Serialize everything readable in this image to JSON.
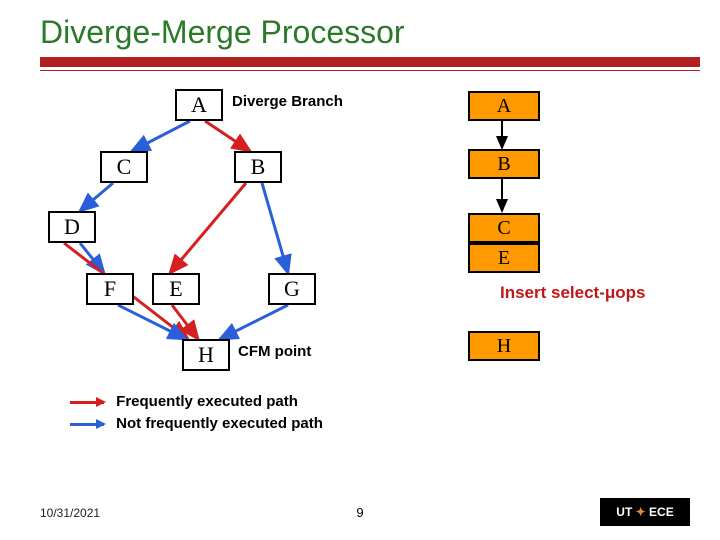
{
  "title": "Diverge-Merge Processor",
  "nodes": {
    "A": "A",
    "B": "B",
    "C": "C",
    "D": "D",
    "E": "E",
    "F": "F",
    "G": "G",
    "H": "H"
  },
  "labels": {
    "diverge": "Diverge Branch",
    "cfm": "CFM point",
    "insert": "Insert select-μops"
  },
  "bars": {
    "A": "A",
    "B": "B",
    "C": "C",
    "E": "E",
    "H": "H"
  },
  "legend": {
    "freq": "Frequently executed path",
    "notfreq": "Not frequently executed path"
  },
  "footer": {
    "date": "10/31/2021",
    "page": "9",
    "logo_left": "UT",
    "logo_right": "ECE"
  }
}
